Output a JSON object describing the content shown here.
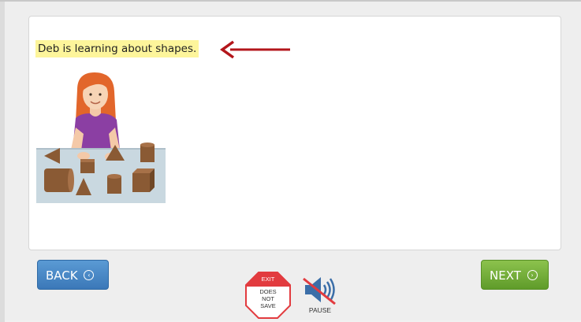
{
  "activity": {
    "sentence": "Deb is learning about shapes."
  },
  "navigation": {
    "back_label": "BACK",
    "next_label": "NEXT"
  },
  "exit": {
    "title": "EXIT",
    "line1": "DOES",
    "line2": "NOT",
    "line3": "SAVE"
  },
  "audio": {
    "pause_label": "PAUSE",
    "state": "muted"
  },
  "colors": {
    "highlight": "#fdf59b",
    "arrow": "#b3161b",
    "back_button": "#4a89c8",
    "next_button": "#76ad3a",
    "exit_sign": "#e23b3f"
  },
  "icons": {
    "arrow": "left-arrow-icon",
    "exit": "stop-sign-icon",
    "audio": "speaker-muted-icon",
    "back": "circle-arrow-left-icon",
    "next": "circle-arrow-right-icon"
  }
}
